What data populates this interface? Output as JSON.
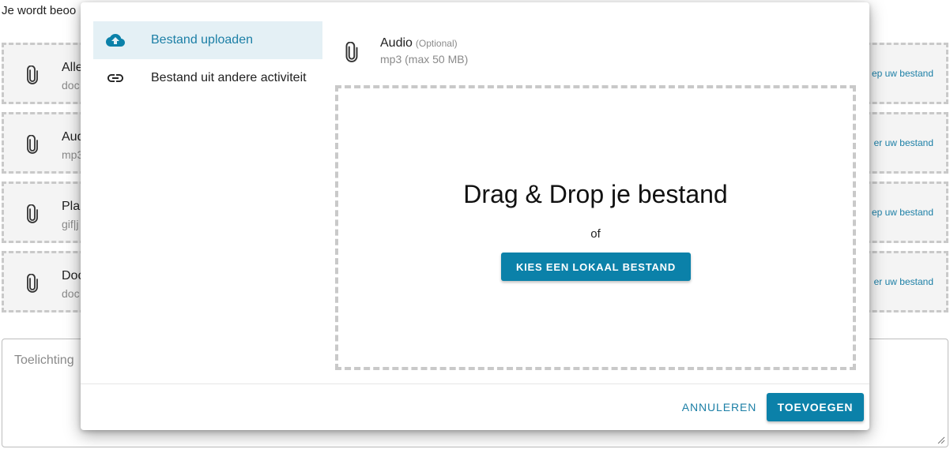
{
  "background": {
    "intro": "Je wordt beoo",
    "cards": [
      {
        "title": "Alle",
        "subtitle": "doc",
        "link": "ep uw bestand"
      },
      {
        "title": "Aud",
        "subtitle": "mp3",
        "link": "er uw bestand"
      },
      {
        "title": "Pla",
        "subtitle": "gif|j",
        "link": "ep uw bestand"
      },
      {
        "title": "Doc",
        "subtitle": "doc",
        "link": "er uw bestand"
      }
    ],
    "textarea_placeholder": "Toelichting"
  },
  "modal": {
    "menu": [
      {
        "label": "Bestand uploaden",
        "icon": "cloud-upload-icon",
        "active": true
      },
      {
        "label": "Bestand uit andere activiteit",
        "icon": "link-icon",
        "active": false
      }
    ],
    "file": {
      "name": "Audio",
      "optional": "(Optional)",
      "requirements": "mp3 (max 50 MB)",
      "icon": "paperclip-icon"
    },
    "dropzone": {
      "title": "Drag & Drop je bestand",
      "or": "of",
      "button": "KIES EEN LOKAAL BESTAND"
    },
    "footer": {
      "cancel": "ANNULEREN",
      "add": "TOEVOEGEN"
    }
  },
  "colors": {
    "accent": "#0b81a9",
    "link": "#1c7fa6",
    "active_bg": "#e4f0f5"
  }
}
